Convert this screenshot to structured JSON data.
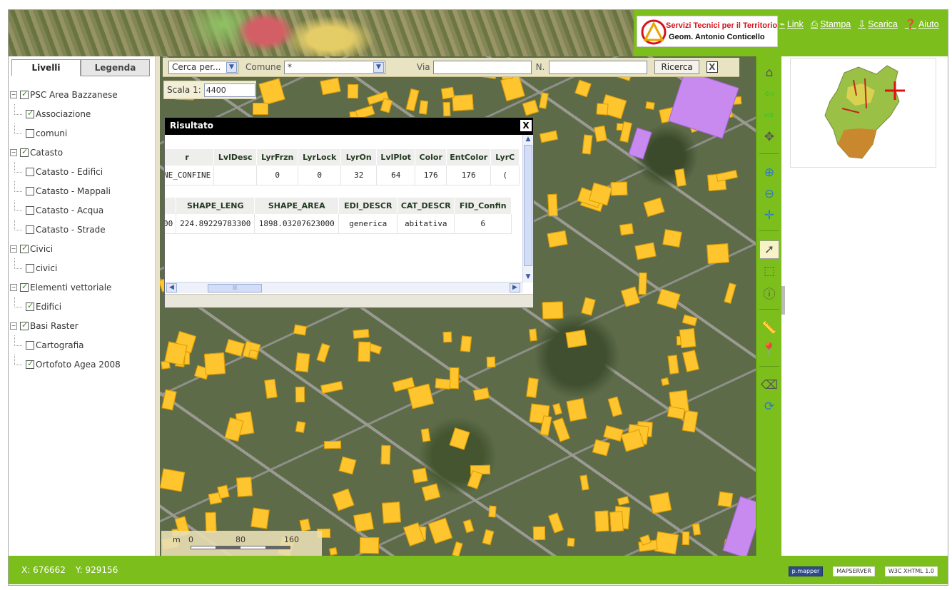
{
  "header": {
    "logo": {
      "line1": "Servizi Tecnici per il Territorio",
      "line2": "Geom. Antonio Conticello"
    },
    "links": [
      {
        "label": "Link",
        "icon": "link-icon"
      },
      {
        "label": "Stampa",
        "icon": "printer-icon"
      },
      {
        "label": "Scarica",
        "icon": "download-icon"
      },
      {
        "label": "Aiuto",
        "icon": "help-icon"
      }
    ]
  },
  "sidebar": {
    "tabs": [
      "Livelli",
      "Legenda"
    ],
    "tree": [
      {
        "label": "PSC Area Bazzanese",
        "checked": true,
        "children": [
          {
            "label": "Associazione",
            "checked": true
          },
          {
            "label": "comuni",
            "checked": false
          }
        ]
      },
      {
        "label": "Catasto",
        "checked": true,
        "children": [
          {
            "label": "Catasto - Edifici",
            "checked": false
          },
          {
            "label": "Catasto - Mappali",
            "checked": false
          },
          {
            "label": "Catasto - Acqua",
            "checked": false
          },
          {
            "label": "Catasto - Strade",
            "checked": false
          }
        ]
      },
      {
        "label": "Civici",
        "checked": true,
        "children": [
          {
            "label": "civici",
            "checked": false
          }
        ]
      },
      {
        "label": "Elementi vettoriale",
        "checked": true,
        "children": [
          {
            "label": "Edifici",
            "checked": true
          }
        ]
      },
      {
        "label": "Basi Raster",
        "checked": true,
        "children": [
          {
            "label": "Cartografia",
            "checked": false
          },
          {
            "label": "Ortofoto Agea 2008",
            "checked": true
          }
        ]
      }
    ]
  },
  "search": {
    "cerca_label": "Cerca per...",
    "comune_label": "Comune",
    "comune_value": "*",
    "via_label": "Via",
    "n_label": "N.",
    "ricerca_label": "Ricerca",
    "close_label": "X"
  },
  "scale": {
    "label": "Scala 1:",
    "value": "4400"
  },
  "result": {
    "title": "Risultato",
    "close_label": "X",
    "table1": {
      "headers": [
        "r",
        "LvlDesc",
        "LyrFrzn",
        "LyrLock",
        "LyrOn",
        "LvlPlot",
        "Color",
        "EntColor",
        "LyrC"
      ],
      "row": [
        "NE_CONFINE",
        "",
        "0",
        "0",
        "32",
        "64",
        "176",
        "176",
        "("
      ]
    },
    "table2": {
      "headers": [
        "",
        "SHAPE_LENG",
        "SHAPE_AREA",
        "EDI_DESCR",
        "CAT_DESCR",
        "FID_Confin"
      ],
      "row": [
        "00",
        "224.89229783300",
        "1898.03207623000",
        "generica",
        "abitativa",
        "6"
      ]
    },
    "hscroll_grip": "|||"
  },
  "scalebar": {
    "unit": "m",
    "ticks": [
      "0",
      "80",
      "160"
    ]
  },
  "toolbar": [
    {
      "name": "home-icon",
      "glyph": "⌂"
    },
    {
      "name": "back-arrow-icon",
      "glyph": "⇦"
    },
    {
      "name": "forward-arrow-icon",
      "glyph": "⇨"
    },
    {
      "name": "zoom-extent-icon",
      "glyph": "✥"
    },
    {
      "name": "zoom-in-icon",
      "glyph": "⊕"
    },
    {
      "name": "zoom-out-icon",
      "glyph": "⊖"
    },
    {
      "name": "pan-icon",
      "glyph": "✛"
    },
    {
      "name": "identify-icon",
      "glyph": "➚"
    },
    {
      "name": "select-icon",
      "glyph": "⬚"
    },
    {
      "name": "info-icon",
      "glyph": "ⓘ"
    },
    {
      "name": "measure-icon",
      "glyph": "📏"
    },
    {
      "name": "point-marker-icon",
      "glyph": "📍"
    },
    {
      "name": "clear-icon",
      "glyph": "⌫"
    },
    {
      "name": "refresh-icon",
      "glyph": "⟳"
    }
  ],
  "footer": {
    "x_label": "X:",
    "x_value": "676662",
    "y_label": "Y:",
    "y_value": "929156",
    "badges": [
      "p.mapper",
      "MAPSERVER",
      "W3C XHTML 1.0"
    ]
  },
  "colors": {
    "accent_green": "#7cbf1c",
    "building": "#ffc52e",
    "special_building": "#c98af0"
  }
}
